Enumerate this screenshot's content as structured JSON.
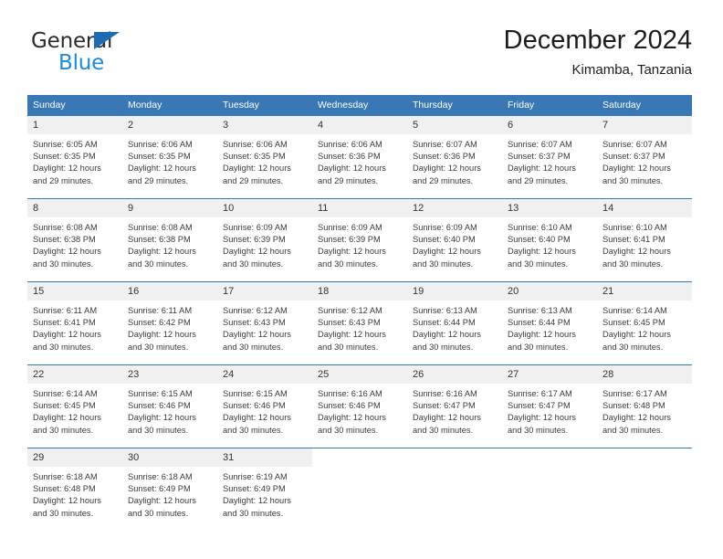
{
  "brand": {
    "name_part1": "General",
    "name_part2": "Blue",
    "triangle_icon": "triangle-icon",
    "color_dark": "#2b2b2b",
    "color_blue": "#1b8ae0",
    "color_triangle": "#1b6cb5"
  },
  "header": {
    "title": "December 2024",
    "subtitle": "Kimamba, Tanzania"
  },
  "theme": {
    "header_bg": "#3878b4",
    "header_text": "#ffffff",
    "daynum_bg": "#f0f0f0",
    "row_border": "#3878b4",
    "body_text": "#3a3a3a"
  },
  "weekday_headers": [
    "Sunday",
    "Monday",
    "Tuesday",
    "Wednesday",
    "Thursday",
    "Friday",
    "Saturday"
  ],
  "weeks": [
    [
      {
        "day": "1",
        "sunrise": "Sunrise: 6:05 AM",
        "sunset": "Sunset: 6:35 PM",
        "daylight_line1": "Daylight: 12 hours",
        "daylight_line2": "and 29 minutes."
      },
      {
        "day": "2",
        "sunrise": "Sunrise: 6:06 AM",
        "sunset": "Sunset: 6:35 PM",
        "daylight_line1": "Daylight: 12 hours",
        "daylight_line2": "and 29 minutes."
      },
      {
        "day": "3",
        "sunrise": "Sunrise: 6:06 AM",
        "sunset": "Sunset: 6:35 PM",
        "daylight_line1": "Daylight: 12 hours",
        "daylight_line2": "and 29 minutes."
      },
      {
        "day": "4",
        "sunrise": "Sunrise: 6:06 AM",
        "sunset": "Sunset: 6:36 PM",
        "daylight_line1": "Daylight: 12 hours",
        "daylight_line2": "and 29 minutes."
      },
      {
        "day": "5",
        "sunrise": "Sunrise: 6:07 AM",
        "sunset": "Sunset: 6:36 PM",
        "daylight_line1": "Daylight: 12 hours",
        "daylight_line2": "and 29 minutes."
      },
      {
        "day": "6",
        "sunrise": "Sunrise: 6:07 AM",
        "sunset": "Sunset: 6:37 PM",
        "daylight_line1": "Daylight: 12 hours",
        "daylight_line2": "and 29 minutes."
      },
      {
        "day": "7",
        "sunrise": "Sunrise: 6:07 AM",
        "sunset": "Sunset: 6:37 PM",
        "daylight_line1": "Daylight: 12 hours",
        "daylight_line2": "and 30 minutes."
      }
    ],
    [
      {
        "day": "8",
        "sunrise": "Sunrise: 6:08 AM",
        "sunset": "Sunset: 6:38 PM",
        "daylight_line1": "Daylight: 12 hours",
        "daylight_line2": "and 30 minutes."
      },
      {
        "day": "9",
        "sunrise": "Sunrise: 6:08 AM",
        "sunset": "Sunset: 6:38 PM",
        "daylight_line1": "Daylight: 12 hours",
        "daylight_line2": "and 30 minutes."
      },
      {
        "day": "10",
        "sunrise": "Sunrise: 6:09 AM",
        "sunset": "Sunset: 6:39 PM",
        "daylight_line1": "Daylight: 12 hours",
        "daylight_line2": "and 30 minutes."
      },
      {
        "day": "11",
        "sunrise": "Sunrise: 6:09 AM",
        "sunset": "Sunset: 6:39 PM",
        "daylight_line1": "Daylight: 12 hours",
        "daylight_line2": "and 30 minutes."
      },
      {
        "day": "12",
        "sunrise": "Sunrise: 6:09 AM",
        "sunset": "Sunset: 6:40 PM",
        "daylight_line1": "Daylight: 12 hours",
        "daylight_line2": "and 30 minutes."
      },
      {
        "day": "13",
        "sunrise": "Sunrise: 6:10 AM",
        "sunset": "Sunset: 6:40 PM",
        "daylight_line1": "Daylight: 12 hours",
        "daylight_line2": "and 30 minutes."
      },
      {
        "day": "14",
        "sunrise": "Sunrise: 6:10 AM",
        "sunset": "Sunset: 6:41 PM",
        "daylight_line1": "Daylight: 12 hours",
        "daylight_line2": "and 30 minutes."
      }
    ],
    [
      {
        "day": "15",
        "sunrise": "Sunrise: 6:11 AM",
        "sunset": "Sunset: 6:41 PM",
        "daylight_line1": "Daylight: 12 hours",
        "daylight_line2": "and 30 minutes."
      },
      {
        "day": "16",
        "sunrise": "Sunrise: 6:11 AM",
        "sunset": "Sunset: 6:42 PM",
        "daylight_line1": "Daylight: 12 hours",
        "daylight_line2": "and 30 minutes."
      },
      {
        "day": "17",
        "sunrise": "Sunrise: 6:12 AM",
        "sunset": "Sunset: 6:43 PM",
        "daylight_line1": "Daylight: 12 hours",
        "daylight_line2": "and 30 minutes."
      },
      {
        "day": "18",
        "sunrise": "Sunrise: 6:12 AM",
        "sunset": "Sunset: 6:43 PM",
        "daylight_line1": "Daylight: 12 hours",
        "daylight_line2": "and 30 minutes."
      },
      {
        "day": "19",
        "sunrise": "Sunrise: 6:13 AM",
        "sunset": "Sunset: 6:44 PM",
        "daylight_line1": "Daylight: 12 hours",
        "daylight_line2": "and 30 minutes."
      },
      {
        "day": "20",
        "sunrise": "Sunrise: 6:13 AM",
        "sunset": "Sunset: 6:44 PM",
        "daylight_line1": "Daylight: 12 hours",
        "daylight_line2": "and 30 minutes."
      },
      {
        "day": "21",
        "sunrise": "Sunrise: 6:14 AM",
        "sunset": "Sunset: 6:45 PM",
        "daylight_line1": "Daylight: 12 hours",
        "daylight_line2": "and 30 minutes."
      }
    ],
    [
      {
        "day": "22",
        "sunrise": "Sunrise: 6:14 AM",
        "sunset": "Sunset: 6:45 PM",
        "daylight_line1": "Daylight: 12 hours",
        "daylight_line2": "and 30 minutes."
      },
      {
        "day": "23",
        "sunrise": "Sunrise: 6:15 AM",
        "sunset": "Sunset: 6:46 PM",
        "daylight_line1": "Daylight: 12 hours",
        "daylight_line2": "and 30 minutes."
      },
      {
        "day": "24",
        "sunrise": "Sunrise: 6:15 AM",
        "sunset": "Sunset: 6:46 PM",
        "daylight_line1": "Daylight: 12 hours",
        "daylight_line2": "and 30 minutes."
      },
      {
        "day": "25",
        "sunrise": "Sunrise: 6:16 AM",
        "sunset": "Sunset: 6:46 PM",
        "daylight_line1": "Daylight: 12 hours",
        "daylight_line2": "and 30 minutes."
      },
      {
        "day": "26",
        "sunrise": "Sunrise: 6:16 AM",
        "sunset": "Sunset: 6:47 PM",
        "daylight_line1": "Daylight: 12 hours",
        "daylight_line2": "and 30 minutes."
      },
      {
        "day": "27",
        "sunrise": "Sunrise: 6:17 AM",
        "sunset": "Sunset: 6:47 PM",
        "daylight_line1": "Daylight: 12 hours",
        "daylight_line2": "and 30 minutes."
      },
      {
        "day": "28",
        "sunrise": "Sunrise: 6:17 AM",
        "sunset": "Sunset: 6:48 PM",
        "daylight_line1": "Daylight: 12 hours",
        "daylight_line2": "and 30 minutes."
      }
    ],
    [
      {
        "day": "29",
        "sunrise": "Sunrise: 6:18 AM",
        "sunset": "Sunset: 6:48 PM",
        "daylight_line1": "Daylight: 12 hours",
        "daylight_line2": "and 30 minutes."
      },
      {
        "day": "30",
        "sunrise": "Sunrise: 6:18 AM",
        "sunset": "Sunset: 6:49 PM",
        "daylight_line1": "Daylight: 12 hours",
        "daylight_line2": "and 30 minutes."
      },
      {
        "day": "31",
        "sunrise": "Sunrise: 6:19 AM",
        "sunset": "Sunset: 6:49 PM",
        "daylight_line1": "Daylight: 12 hours",
        "daylight_line2": "and 30 minutes."
      },
      {
        "day": "",
        "sunrise": "",
        "sunset": "",
        "daylight_line1": "",
        "daylight_line2": ""
      },
      {
        "day": "",
        "sunrise": "",
        "sunset": "",
        "daylight_line1": "",
        "daylight_line2": ""
      },
      {
        "day": "",
        "sunrise": "",
        "sunset": "",
        "daylight_line1": "",
        "daylight_line2": ""
      },
      {
        "day": "",
        "sunrise": "",
        "sunset": "",
        "daylight_line1": "",
        "daylight_line2": ""
      }
    ]
  ]
}
